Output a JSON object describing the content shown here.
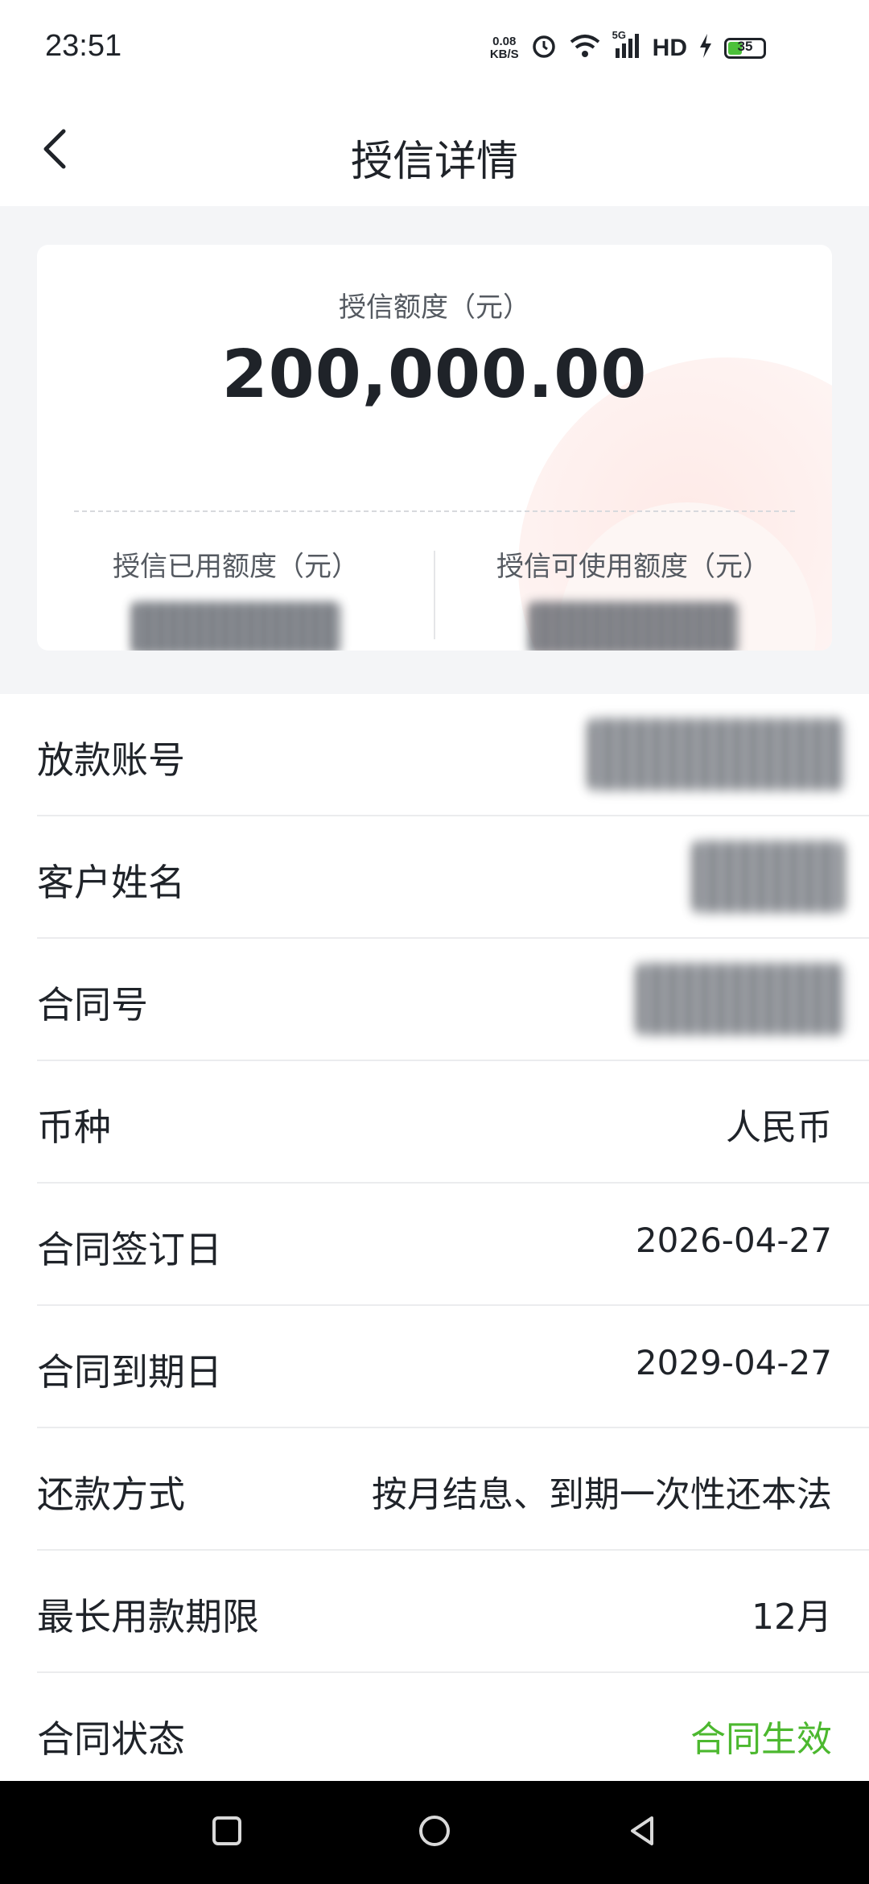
{
  "status_bar": {
    "time": "23:51",
    "net_speed_value": "0.08",
    "net_speed_unit": "KB/S",
    "signal_label": "5G",
    "hd_label": "HD",
    "battery_level": "35"
  },
  "nav": {
    "title": "授信详情"
  },
  "credit_card": {
    "limit_label": "授信额度（元）",
    "limit_amount": "200,000.00",
    "used_label": "授信已用额度（元）",
    "available_label": "授信可使用额度（元）"
  },
  "details": {
    "account_label": "放款账号",
    "customer_label": "客户姓名",
    "contract_no_label": "合同号",
    "currency_label": "币种",
    "currency_value": "人民币",
    "sign_date_label": "合同签订日",
    "sign_date_value": "2026-04-27",
    "expiry_date_label": "合同到期日",
    "expiry_date_value": "2029-04-27",
    "repayment_label": "还款方式",
    "repayment_value": "按月结息、到期一次性还本法",
    "max_term_label": "最长用款期限",
    "max_term_value": "12月",
    "status_label": "合同状态",
    "status_value": "合同生效"
  },
  "colors": {
    "status_green": "#4cb82f",
    "page_bg": "#f4f5f7",
    "text_primary": "#1f2329",
    "text_secondary": "#555a61"
  },
  "icons": {
    "back": "chevron-left-icon",
    "alarm": "alarm-icon",
    "wifi": "wifi-icon",
    "signal": "signal-icon",
    "charging": "bolt-icon",
    "battery": "battery-icon",
    "recent_apps": "square-icon",
    "home": "circle-icon",
    "back_nav": "triangle-back-icon"
  }
}
